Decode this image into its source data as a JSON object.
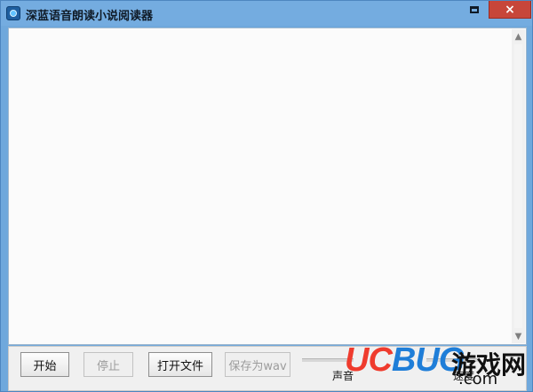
{
  "window": {
    "title": "深蓝语音朗读小说阅读器",
    "icon": "app-icon",
    "controls": {
      "minimize": "minimize-icon",
      "maximize": "maximize-icon",
      "close": "close-icon"
    }
  },
  "editor": {
    "text": "",
    "scrollbar": {
      "up": "▲",
      "down": "▼"
    }
  },
  "toolbar": {
    "start_label": "开始",
    "stop_label": "停止",
    "open_label": "打开文件",
    "save_label": "保存为wav",
    "volume_label": "声音",
    "speed_label": "速度"
  },
  "watermark": {
    "logo_uc": "UC",
    "logo_bug": "BUG",
    "chinese": "游戏网",
    "domain": ".com",
    "colors": {
      "uc": "#ef3b2d",
      "bug": "#1f7ed8"
    }
  }
}
